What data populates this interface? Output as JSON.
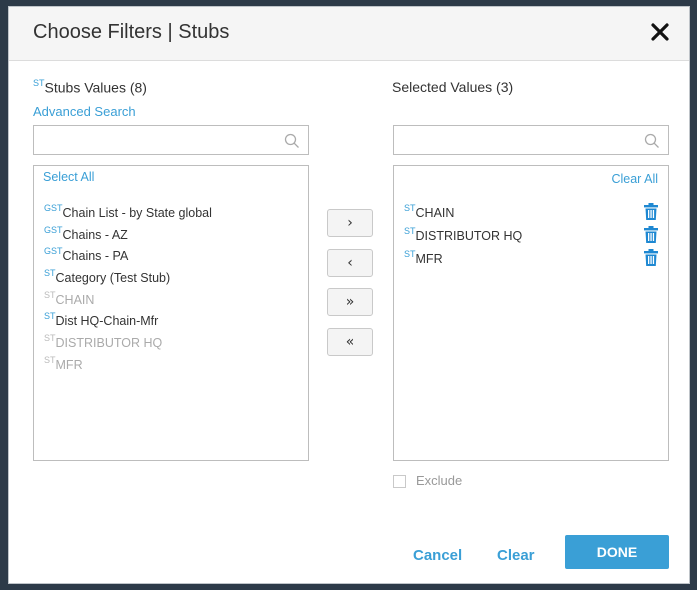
{
  "dialog": {
    "title": "Choose Filters | Stubs",
    "close_icon": "close-icon"
  },
  "left": {
    "sup": "ST",
    "title": "Stubs Values (8)",
    "advanced_search": "Advanced Search",
    "search_placeholder": "",
    "select_all": "Select All",
    "items": [
      {
        "sup": "GST",
        "label": "Chain List - by State global",
        "disabled": false
      },
      {
        "sup": "GST",
        "label": "Chains - AZ",
        "disabled": false
      },
      {
        "sup": "GST",
        "label": "Chains - PA",
        "disabled": false
      },
      {
        "sup": "ST",
        "label": "Category (Test Stub)",
        "disabled": false
      },
      {
        "sup": "ST",
        "label": "CHAIN",
        "disabled": true
      },
      {
        "sup": "ST",
        "label": "Dist HQ-Chain-Mfr",
        "disabled": false
      },
      {
        "sup": "ST",
        "label": "DISTRIBUTOR HQ",
        "disabled": true
      },
      {
        "sup": "ST",
        "label": "MFR",
        "disabled": true
      }
    ]
  },
  "transfer": {
    "add": "›",
    "remove": "‹",
    "add_all": "»",
    "remove_all": "«"
  },
  "right": {
    "title": "Selected Values (3)",
    "search_placeholder": "",
    "clear_all": "Clear All",
    "items": [
      {
        "sup": "ST",
        "label": "CHAIN"
      },
      {
        "sup": "ST",
        "label": "DISTRIBUTOR HQ"
      },
      {
        "sup": "ST",
        "label": "MFR"
      }
    ],
    "exclude_label": "Exclude",
    "exclude_checked": false
  },
  "footer": {
    "cancel": "Cancel",
    "clear": "Clear",
    "done": "DONE"
  },
  "colors": {
    "accent": "#3a9fd6",
    "disabled_text": "#aaaaaa"
  }
}
